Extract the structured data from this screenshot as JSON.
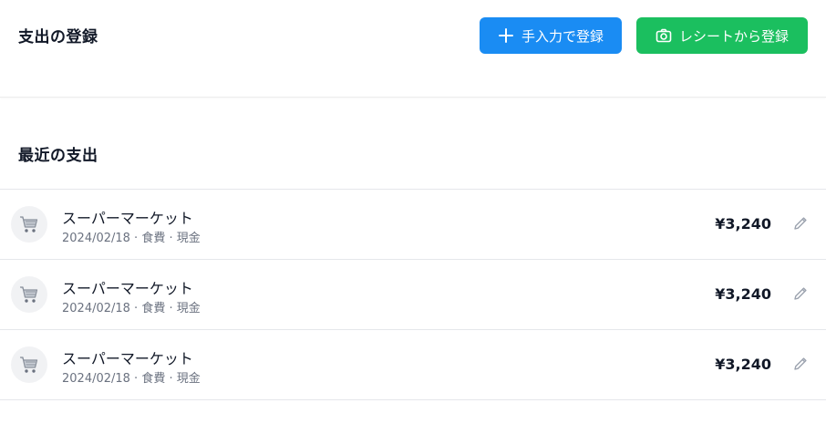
{
  "header": {
    "title": "支出の登録",
    "manual_button": "手入力で登録",
    "receipt_button": "レシートから登録"
  },
  "recent": {
    "title": "最近の支出",
    "items": [
      {
        "store": "スーパーマーケット",
        "date": "2024/02/18",
        "category": "食費",
        "method": "現金",
        "meta": "2024/02/18 · 食費 · 現金",
        "amount": "¥3,240",
        "icon": "shopping-cart-icon"
      },
      {
        "store": "スーパーマーケット",
        "date": "2024/02/18",
        "category": "食費",
        "method": "現金",
        "meta": "2024/02/18 · 食費 · 現金",
        "amount": "¥3,240",
        "icon": "shopping-cart-icon"
      },
      {
        "store": "スーパーマーケット",
        "date": "2024/02/18",
        "category": "食費",
        "method": "現金",
        "meta": "2024/02/18 · 食費 · 現金",
        "amount": "¥3,240",
        "icon": "shopping-cart-icon"
      }
    ]
  },
  "colors": {
    "primary_blue": "#1a8cf3",
    "primary_green": "#1bbf5f",
    "muted_text": "#6b7280"
  }
}
